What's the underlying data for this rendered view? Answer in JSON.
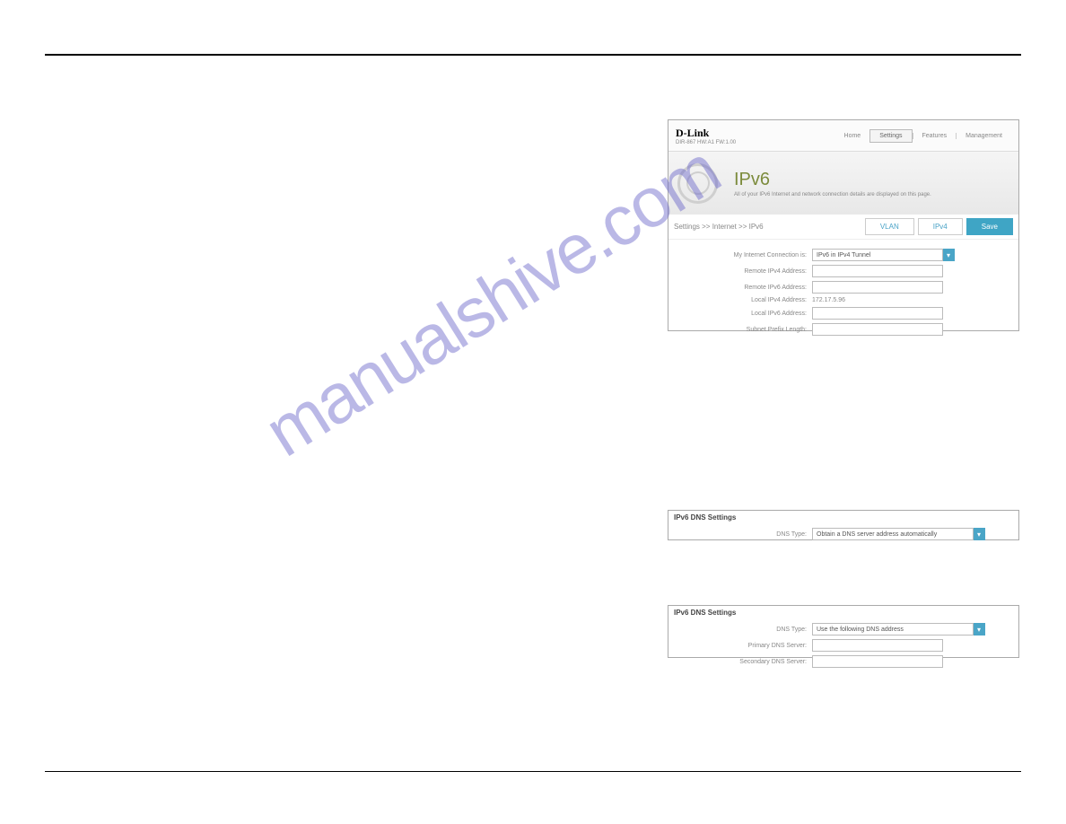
{
  "brand": "D-Link",
  "subbrand": "DIR-867 HW:A1 FW:1.00",
  "nav": {
    "home": "Home",
    "settings": "Settings",
    "features": "Features",
    "management": "Management"
  },
  "header": {
    "title": "IPv6",
    "desc": "All of your IPv6 Internet and network connection details are displayed on this page."
  },
  "breadcrumb": "Settings >> Internet >> IPv6",
  "tabs": {
    "vlan": "VLAN",
    "ipv4": "IPv4",
    "save": "Save"
  },
  "form": {
    "conn_label": "My Internet Connection is:",
    "conn_value": "IPv6 in IPv4 Tunnel",
    "remote_ipv4": "Remote IPv4 Address:",
    "remote_ipv6": "Remote IPv6 Address:",
    "local_ipv4": "Local IPv4 Address:",
    "local_ipv4_val": "172.17.5.96",
    "local_ipv6": "Local IPv6 Address:",
    "subnet": "Subnet Prefix Length:"
  },
  "dns": {
    "section": "IPv6 DNS Settings",
    "type_label": "DNS Type:",
    "auto": "Obtain a DNS server address automatically",
    "manual": "Use the following DNS address",
    "primary": "Primary DNS Server:",
    "secondary": "Secondary DNS Server:"
  },
  "watermark": "manualshive.com"
}
